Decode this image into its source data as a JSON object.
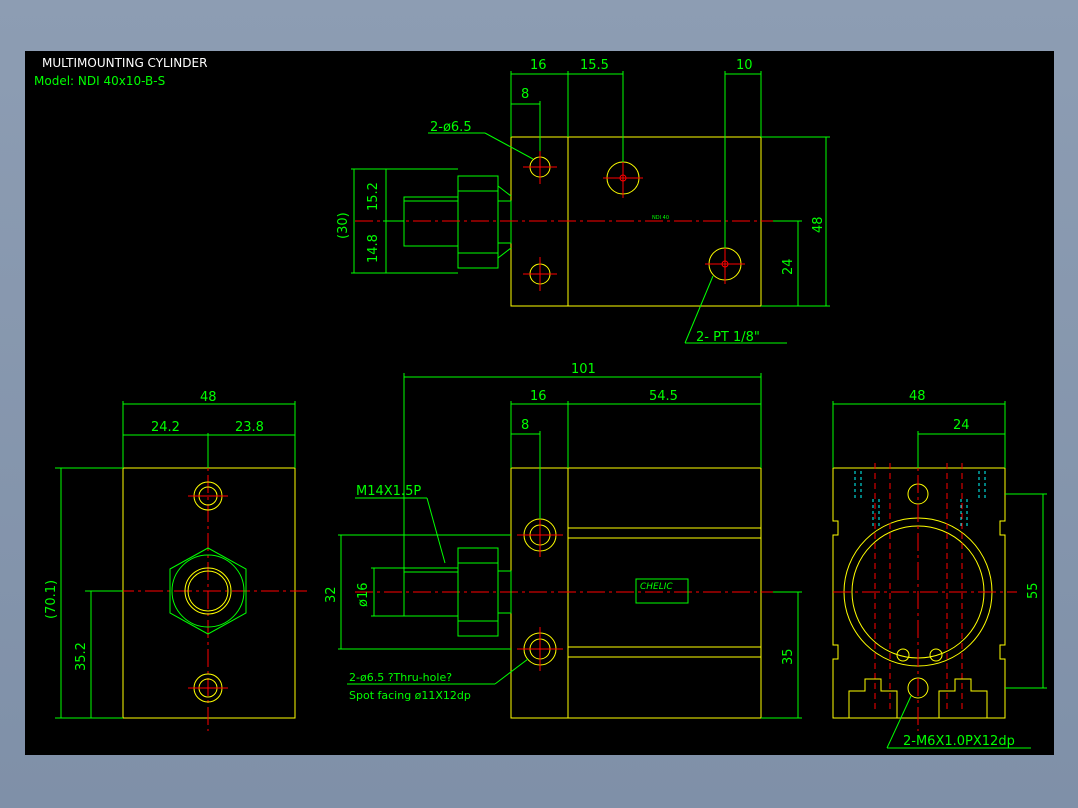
{
  "title": {
    "line1": "MULTIMOUNTING CYLINDER",
    "line2": "Model:  NDI  40x10-B-S"
  },
  "top_view": {
    "dims": {
      "d16": "16",
      "d15_5": "15.5",
      "d10": "10",
      "d8": "8",
      "d15_2": "15.2",
      "d14_8": "14.8",
      "d30": "(30)",
      "d48": "48",
      "d24": "24"
    },
    "callouts": {
      "holes": "2-ø6.5",
      "ports": "2-  PT  1/8\""
    },
    "label": "NDI 40"
  },
  "left_view": {
    "dims": {
      "d48": "48",
      "d24_2": "24.2",
      "d23_8": "23.8",
      "d70_1": "(70.1)",
      "d35_2": "35.2"
    }
  },
  "front_view": {
    "dims": {
      "d101": "101",
      "d16": "16",
      "d54_5": "54.5",
      "d8": "8",
      "d32": "32",
      "d16dia": "ø16",
      "d35": "35"
    },
    "callouts": {
      "thread": "M14X1.5P",
      "holes": "2-ø6.5  ?Thru-hole?",
      "spot": "Spot  facing   ø11X12dp"
    },
    "brand": "CHELIC"
  },
  "right_view": {
    "dims": {
      "d48": "48",
      "d24": "24",
      "d55": "55"
    },
    "callouts": {
      "tap": "2-M6X1.0PX12dp"
    }
  }
}
